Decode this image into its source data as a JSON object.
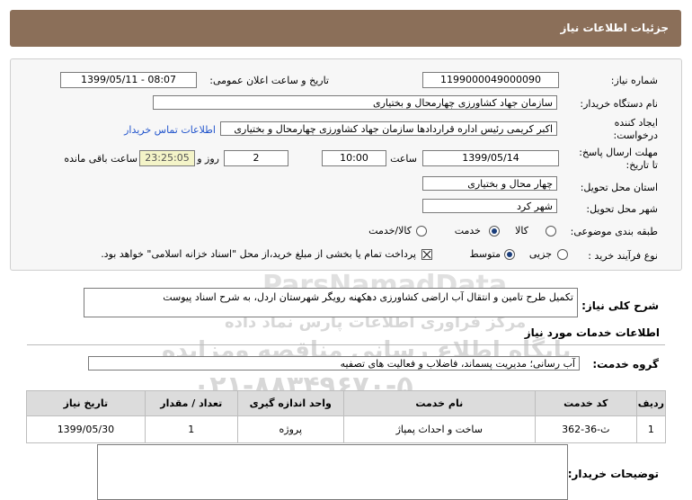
{
  "header": {
    "title": "جزئیات اطلاعات نیاز"
  },
  "form": {
    "need_number_label": "شماره نیاز:",
    "need_number": "1199000049000090",
    "announce_label": "تاریخ و ساعت اعلان عمومی:",
    "announce_value": "1399/05/11 - 08:07",
    "buyer_org_label": "نام دستگاه خریدار:",
    "buyer_org": "سازمان جهاد کشاورزی چهارمحال و بختیاری",
    "creator_label_1": "ایجاد کننده",
    "creator_label_2": "درخواست:",
    "creator": "اکبر کریمی رئیس اداره قراردادها سازمان جهاد کشاورزی چهارمحال و بختیاری",
    "contact_link": "اطلاعات تماس خریدار",
    "deadline_label_1": "مهلت ارسال پاسخ:",
    "deadline_label_2": "تا تاریخ:",
    "deadline_date": "1399/05/14",
    "time_label": "ساعت",
    "deadline_time": "10:00",
    "days_value": "2",
    "days_label": "روز و",
    "remaining_time": "23:25:05",
    "remaining_label": "ساعت باقی مانده",
    "province_label": "استان محل تحویل:",
    "province": "چهار محال و بختیاری",
    "city_label": "شهر محل تحویل:",
    "city": "شهر کرد",
    "category_label": "طبقه بندی موضوعی:",
    "category_options": [
      "کالا",
      "خدمت",
      "کالا/خدمت"
    ],
    "category_selected": "خدمت",
    "process_label": "نوع فرآیند خرید :",
    "process_options": [
      "جزیی",
      "متوسط"
    ],
    "process_selected": "متوسط",
    "payment_note": "پرداخت تمام یا بخشی از مبلغ خرید،از محل \"اسناد خزانه اسلامی\" خواهد بود.",
    "payment_checked": true
  },
  "description": {
    "label": "شرح کلی نیاز:",
    "text": "تکمیل طرح تامین و انتقال آب اراضی کشاورزی دهکهنه رویگر شهرستان اردل، به شرح اسناد پیوست"
  },
  "services": {
    "section_title": "اطلاعات خدمات مورد نیاز",
    "group_label": "گروه خدمت:",
    "group_value": "آب رسانی؛ مدیریت پسماند، فاضلاب و فعالیت های تصفیه",
    "columns": [
      "ردیف",
      "کد خدمت",
      "نام خدمت",
      "واحد اندازه گیری",
      "تعداد / مقدار",
      "تاریخ نیاز"
    ],
    "rows": [
      [
        "1",
        "ث-36-362",
        "ساخت و احداث پمپاژ",
        "پروژه",
        "1",
        "1399/05/30"
      ]
    ]
  },
  "buyer_notes": {
    "label": "توضیحات خریدار:"
  },
  "watermark": {
    "brand": "ParsNamadData",
    "line1": "مرکز فراوری اطلاعات پارس نماد داده",
    "line2": "پایگاه اطلاع رسانی مناقصه ومزایده",
    "phone": "۰۲۱-۸۸۳۴۹۶۷۰-۵"
  },
  "colors": {
    "header_bg": "#8b6f59",
    "link": "#2255cc",
    "timer_bg": "#f4f4c8"
  }
}
